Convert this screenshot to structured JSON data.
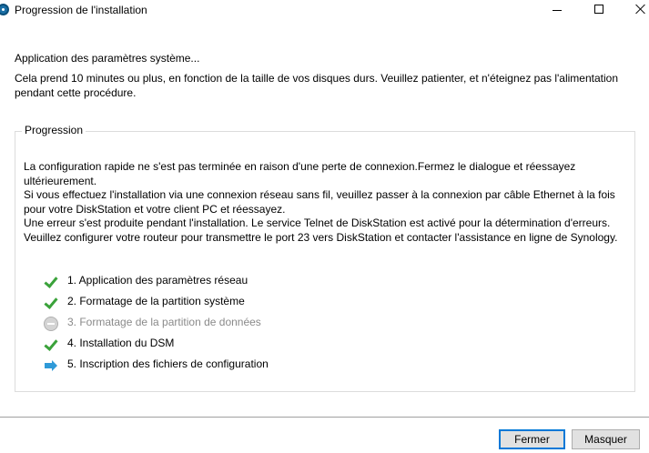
{
  "window": {
    "title": "Progression de l'installation",
    "controls": {
      "minimize": "minimize",
      "maximize": "maximize",
      "close": "close"
    }
  },
  "heading": "Application des paramètres système...",
  "description": "Cela prend 10 minutes ou plus, en fonction de la taille de vos disques durs. Veuillez patienter, et n'éteignez pas l'alimentation pendant cette procédure.",
  "progress": {
    "group_title": "Progression",
    "message": [
      "La configuration rapide ne s'est pas terminée en raison d'une perte de connexion.Fermez le dialogue et réessayez ultérieurement.",
      "Si vous effectuez l'installation via une connexion réseau sans fil, veuillez passer à la connexion par câble Ethernet à la fois pour votre DiskStation et votre client PC et réessayez.",
      "Une erreur s'est produite pendant l'installation. Le service Telnet de DiskStation est activé pour la détermination d'erreurs. Veuillez configurer votre routeur pour transmettre le port 23 vers DiskStation et contacter l'assistance en ligne de Synology."
    ],
    "steps": [
      {
        "label": "1. Application des paramètres réseau",
        "status": "done",
        "icon": "check-icon"
      },
      {
        "label": "2. Formatage de la partition système",
        "status": "done",
        "icon": "check-icon"
      },
      {
        "label": "3. Formatage de la partition de données",
        "status": "pending",
        "icon": "pending-icon"
      },
      {
        "label": "4. Installation du DSM",
        "status": "done",
        "icon": "check-icon"
      },
      {
        "label": "5. Inscription des fichiers de configuration",
        "status": "current",
        "icon": "arrow-icon"
      }
    ]
  },
  "buttons": {
    "close_label": "Fermer",
    "hide_label": "Masquer"
  },
  "colors": {
    "check": "#3aa23a",
    "arrow": "#2f9ad8",
    "pending": "#d4d4d4",
    "pending_text": "#8a8a8a",
    "primary_border": "#0078d7"
  }
}
